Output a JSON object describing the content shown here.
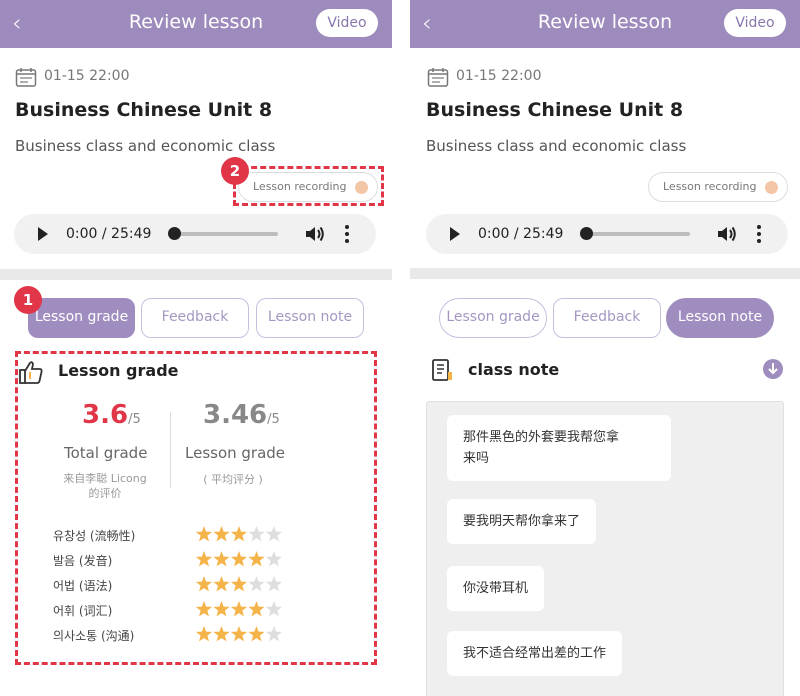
{
  "header": {
    "back_icon": "‹",
    "title": "Review lesson",
    "video_label": "Video"
  },
  "lesson": {
    "date": "01-15 22:00",
    "title": "Business Chinese Unit 8",
    "subtitle": "Business class and economic class",
    "recording_label": "Lesson recording"
  },
  "player": {
    "time": "0:00 / 25:49"
  },
  "tabs": [
    "Lesson grade",
    "Feedback",
    "Lesson note"
  ],
  "annotations": {
    "badge1": "1",
    "badge2": "2"
  },
  "grade": {
    "section_title": "Lesson grade",
    "total_value": "3.6",
    "total_suffix": "/5",
    "total_label": "Total grade",
    "total_source": "来自李聪 Licong\n的评价",
    "lesson_value": "3.46",
    "lesson_suffix": "/5",
    "lesson_label": "Lesson grade",
    "lesson_source": "( 平均评分 )",
    "ratings": [
      {
        "label": "유창성 (流畅性)",
        "stars": 3
      },
      {
        "label": "발음 (发音)",
        "stars": 4
      },
      {
        "label": "어법 (语法)",
        "stars": 3
      },
      {
        "label": "어휘 (词汇)",
        "stars": 4
      },
      {
        "label": "의사소통 (沟通)",
        "stars": 4
      }
    ]
  },
  "note": {
    "section_title": "class note",
    "messages": [
      "那件黑色的外套要我帮您拿\n来吗",
      "要我明天帮你拿来了",
      "你没带耳机",
      "我不适合经常出差的工作"
    ]
  },
  "colors": {
    "header": "#9e8bbd",
    "tab_active": "#a08dbf",
    "accent_red": "#e03648",
    "star": "#f5b44a",
    "star_empty": "#dedede"
  }
}
